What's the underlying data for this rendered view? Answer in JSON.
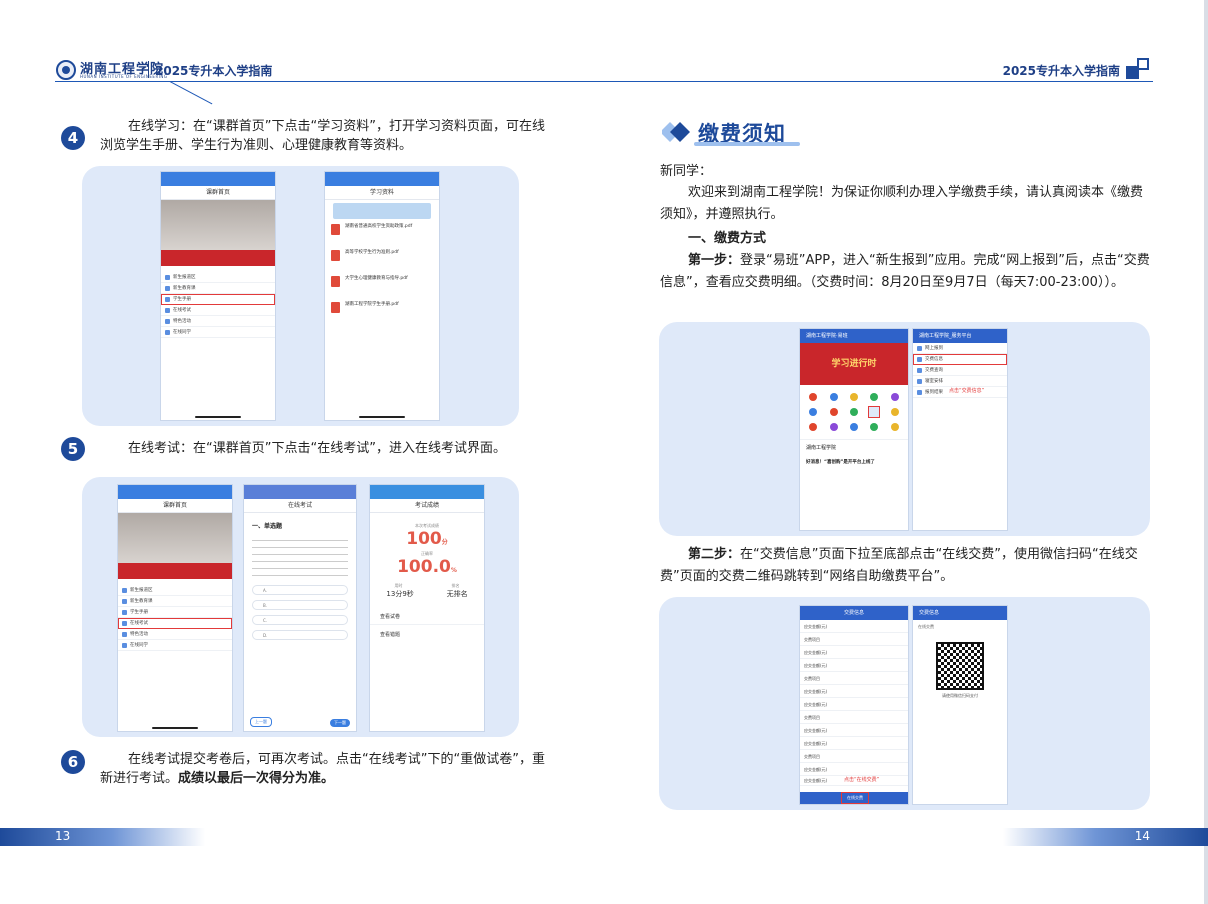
{
  "header": {
    "school_name": "湖南工程学院",
    "school_sub": "HUNAN INSTITUTE OF ENGINEERING",
    "title_left": "2025专升本入学指南",
    "title_right": "2025专升本入学指南"
  },
  "footer": {
    "page_left": "13",
    "page_right": "14"
  },
  "left": {
    "steps": [
      {
        "number": "4",
        "text": "在线学习：在“课群首页”下点击“学习资料”，打开学习资料页面，可在线浏览学生手册、学生行为准则、心理健康教育等资料。"
      },
      {
        "number": "5",
        "text": "在线考试：在“课群首页”下点击“在线考试”，进入在线考试界面。"
      },
      {
        "number": "6",
        "text": "在线考试提交考卷后，可再次考试。点击“在线考试”下的“重做试卷”，重新进行考试。",
        "bold_text": "成绩以最后一次得分为准。"
      }
    ],
    "shot1": {
      "p1_nav": "课群首页",
      "p1_menu": [
        "新生报道区",
        "新生教育课",
        "学生手册",
        "在线考试",
        "特色活动",
        "在线同学"
      ],
      "p2_nav": "学习资料",
      "p2_files": [
        "湖南省普通高校学生资助政策.pdf",
        "高等学校学生行为准则.pdf",
        "大学生心理健康教育与指导.pdf",
        "湖南工程学院学生手册.pdf"
      ]
    },
    "shot2": {
      "p1_nav": "课群首页",
      "p1_menu": [
        "新生报道区",
        "新生教育课",
        "学生手册",
        "在线考试",
        "特色活动",
        "在线同学"
      ],
      "p2_nav": "在线考试",
      "p2_section": "一、单选题",
      "p2_options": [
        "A.",
        "B.",
        "C.",
        "D."
      ],
      "p2_prev": "上一题",
      "p2_next": "下一题",
      "p3_nav": "考试成绩",
      "p3_label1": "本次考试成绩",
      "p3_score": "100",
      "p3_score_unit": "分",
      "p3_label2": "正确率",
      "p3_rate": "100.0",
      "p3_rate_unit": "%",
      "p3_time_label": "用时",
      "p3_time": "13分9秒",
      "p3_rank_label": "排名",
      "p3_rank": "无排名",
      "p3_link1": "查看试卷",
      "p3_link2": "查看错题"
    }
  },
  "right": {
    "section_title": "缴费须知",
    "greeting": "新同学：",
    "intro": "欢迎来到湖南工程学院！为保证你顺利办理入学缴费手续，请认真阅读本《缴费须知》，并遵照执行。",
    "subheading": "一、缴费方式",
    "step1_label": "第一步：",
    "step1_text": "登录“易班”APP，进入“新生报到”应用。完成“网上报到”后，点击“交费信息”，查看应交费明细。（交费时间：8月20日至9月7日（每天7:00-23:00））。",
    "step2_label": "第二步：",
    "step2_text": "在“交费信息”页面下拉至底部点击“在线交费”，使用微信扫码“在线交费”页面的交费二维码跳转到“网络自助缴费平台”。",
    "shot3": {
      "p1_nav": "湖南工程学院·易班",
      "p1_banner": "学习进行时",
      "p1_school": "湖南工程学院",
      "p1_notice": "好消息！“喜创购”是开平台上线了",
      "p2_nav": "湖南工程学院_服务平台",
      "p2_items": [
        "网上报到",
        "交费信息",
        "交费查询",
        "寝室安排",
        "报到结果"
      ],
      "p2_note": "点击“交费信息”"
    },
    "shot4": {
      "p1_nav": "交费信息",
      "p1_rows": [
        "应交金额(元)",
        "交费项目",
        "应交金额(元)",
        "应交金额(元)",
        "交费项目",
        "应交金额(元)",
        "应交金额(元)",
        "交费项目",
        "应交金额(元)",
        "应交金额(元)",
        "交费项目",
        "应交金额(元)",
        "应交金额(元)"
      ],
      "p1_note": "点击“在线交费”",
      "p1_button": "在线交费",
      "p2_nav": "交费信息",
      "p2_label": "在线交费",
      "p2_caption": "请使用微信扫码支付"
    }
  },
  "colors": {
    "brand": "#1e4a9a",
    "panel": "#dfe9f9",
    "highlight": "#e23a3a"
  }
}
